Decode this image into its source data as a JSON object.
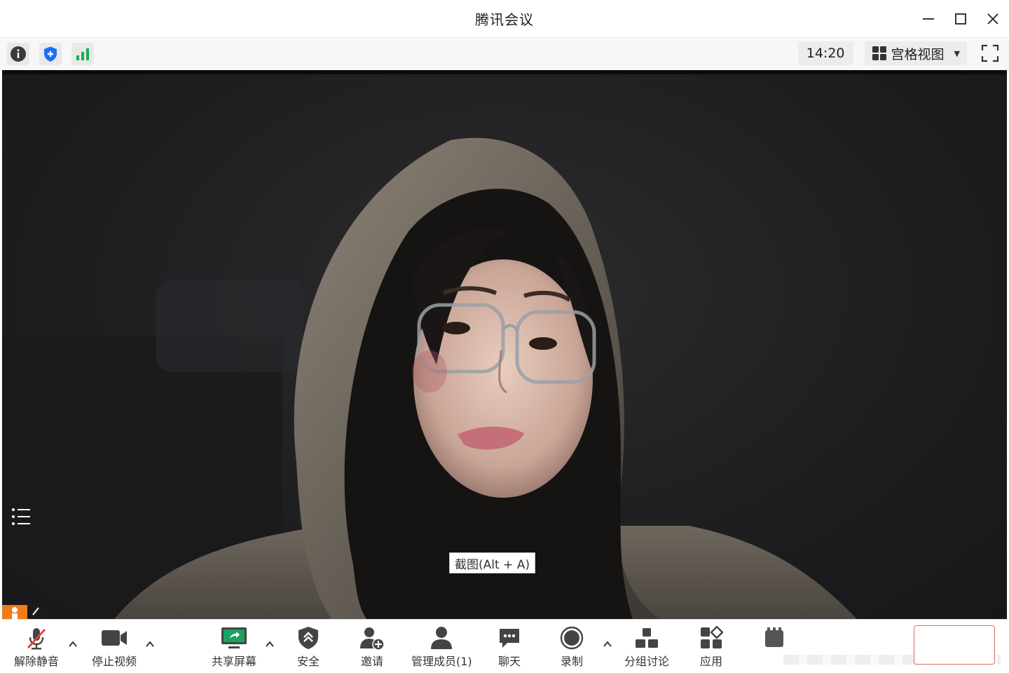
{
  "window": {
    "title": "腾讯会议"
  },
  "infobar": {
    "clock": "14:20",
    "view_mode": "宫格视图"
  },
  "video": {
    "tooltip": "截图(Alt + A)"
  },
  "toolbar": {
    "unmute": "解除静音",
    "stop_video": "停止视频",
    "share_screen": "共享屏幕",
    "security": "安全",
    "invite": "邀请",
    "manage_members": "管理成员(1)",
    "chat": "聊天",
    "record": "录制",
    "breakout": "分组讨论",
    "apps": "应用"
  },
  "colors": {
    "accent_blue": "#1b6ff5",
    "signal_green": "#17b04a",
    "share_green": "#1aa260",
    "mute_red": "#e3413a",
    "pin_orange": "#f07c1b",
    "end_red": "#e06868"
  }
}
